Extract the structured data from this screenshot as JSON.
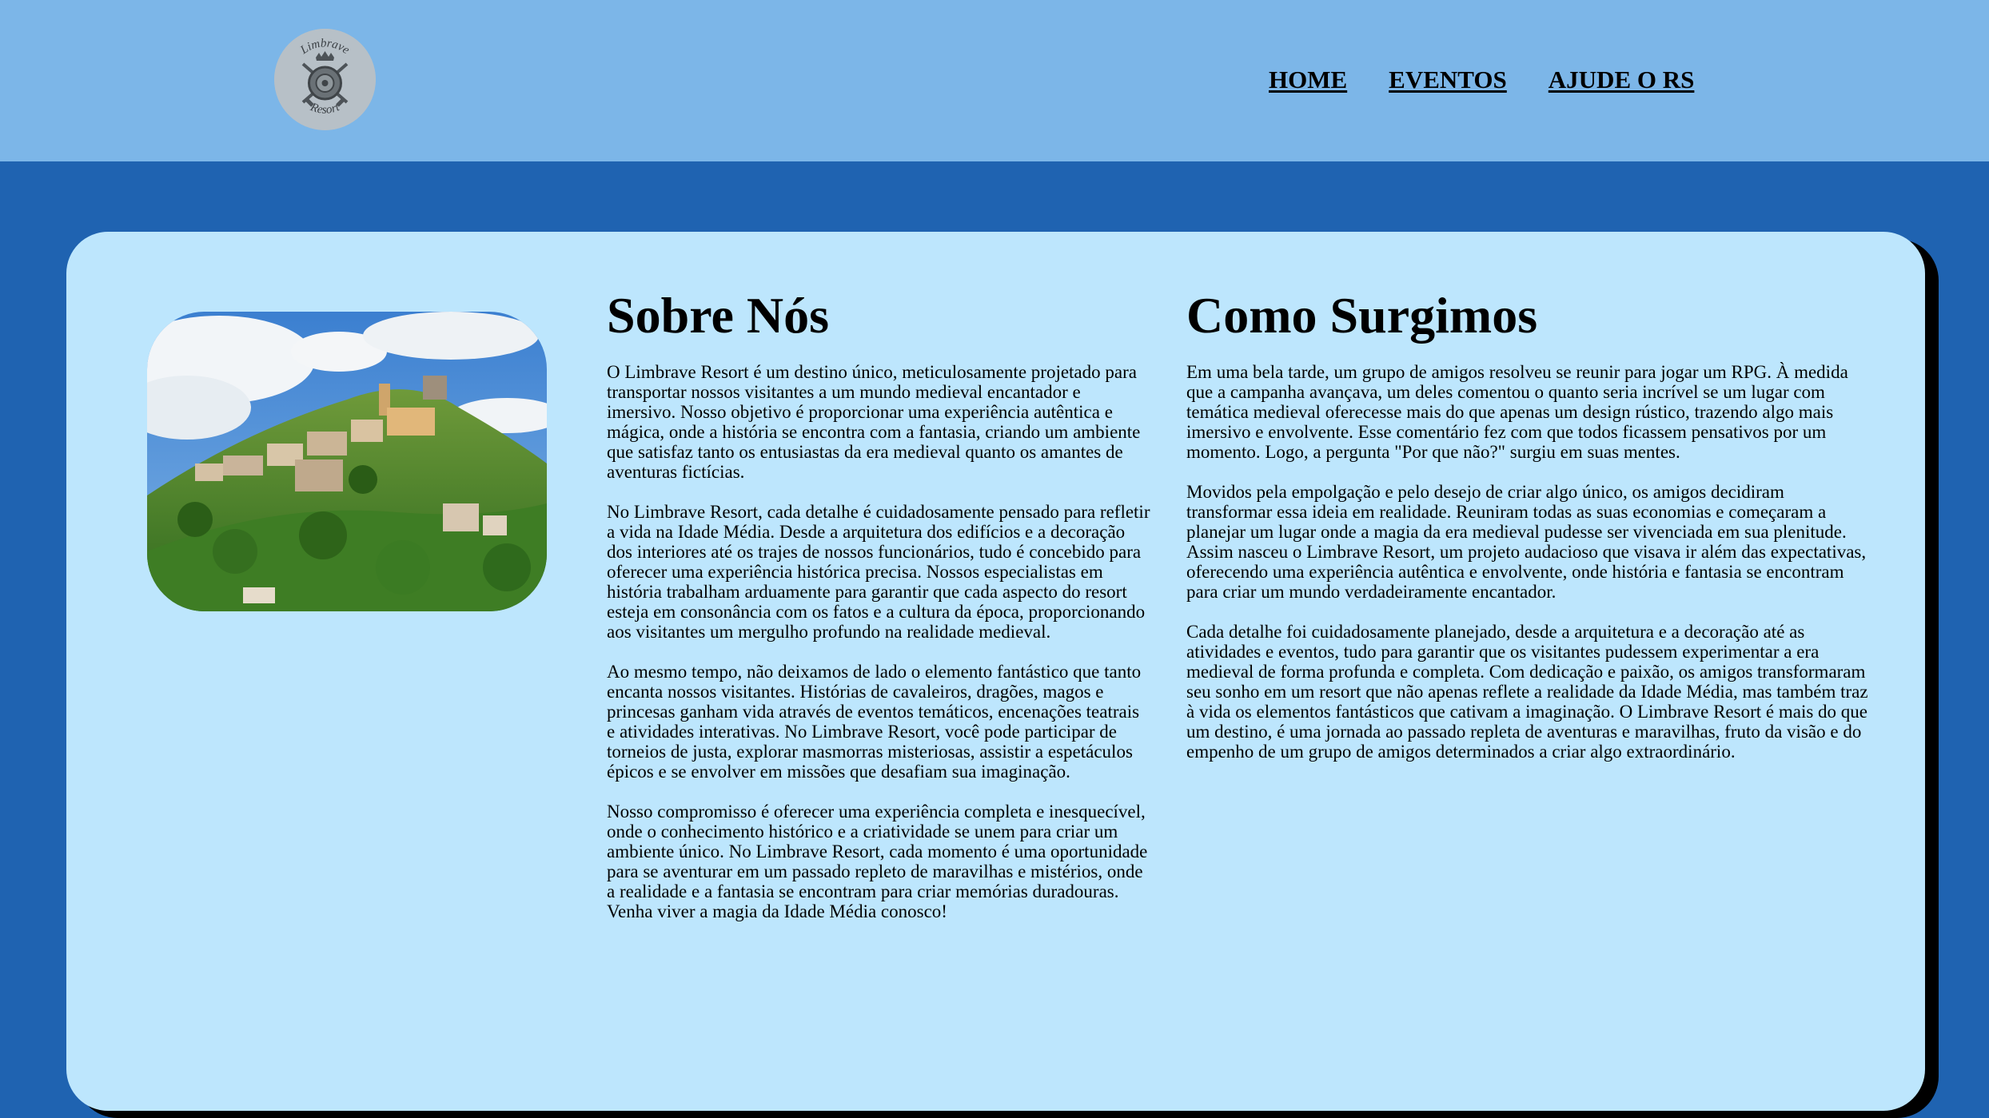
{
  "header": {
    "logo": {
      "icon": "shield-crossed-swords-logo",
      "text_top": "Limbrave",
      "text_bottom": "Resort"
    },
    "nav": [
      {
        "label": "HOME"
      },
      {
        "label": "EVENTOS"
      },
      {
        "label": "AJUDE O RS"
      }
    ]
  },
  "colors": {
    "header_bg": "#7cb6e8",
    "page_bg": "#1f63b1",
    "panel_bg": "#bde6fd",
    "panel_shadow": "#000000"
  },
  "main": {
    "image": {
      "subject": "medieval hilltop village photo"
    },
    "about": {
      "title": "Sobre Nós",
      "paragraphs": [
        "O Limbrave Resort é um destino único, meticulosamente projetado para transportar nossos visitantes a um mundo medieval encantador e imersivo. Nosso objetivo é proporcionar uma experiência autêntica e mágica, onde a história se encontra com a fantasia, criando um ambiente que satisfaz tanto os entusiastas da era medieval quanto os amantes de aventuras fictícias.",
        "No Limbrave Resort, cada detalhe é cuidadosamente pensado para refletir a vida na Idade Média. Desde a arquitetura dos edifícios e a decoração dos interiores até os trajes de nossos funcionários, tudo é concebido para oferecer uma experiência histórica precisa. Nossos especialistas em história trabalham arduamente para garantir que cada aspecto do resort esteja em consonância com os fatos e a cultura da época, proporcionando aos visitantes um mergulho profundo na realidade medieval.",
        "Ao mesmo tempo, não deixamos de lado o elemento fantástico que tanto encanta nossos visitantes. Histórias de cavaleiros, dragões, magos e princesas ganham vida através de eventos temáticos, encenações teatrais e atividades interativas. No Limbrave Resort, você pode participar de torneios de justa, explorar masmorras misteriosas, assistir a espetáculos épicos e se envolver em missões que desafiam sua imaginação.",
        "Nosso compromisso é oferecer uma experiência completa e inesquecível, onde o conhecimento histórico e a criatividade se unem para criar um ambiente único. No Limbrave Resort, cada momento é uma oportunidade para se aventurar em um passado repleto de maravilhas e mistérios, onde a realidade e a fantasia se encontram para criar memórias duradouras. Venha viver a magia da Idade Média conosco!"
      ]
    },
    "origin": {
      "title": "Como Surgimos",
      "paragraphs": [
        "Em uma bela tarde, um grupo de amigos resolveu se reunir para jogar um RPG. À medida que a campanha avançava, um deles comentou o quanto seria incrível se um lugar com temática medieval oferecesse mais do que apenas um design rústico, trazendo algo mais imersivo e envolvente. Esse comentário fez com que todos ficassem pensativos por um momento. Logo, a pergunta \"Por que não?\" surgiu em suas mentes.",
        "Movidos pela empolgação e pelo desejo de criar algo único, os amigos decidiram transformar essa ideia em realidade. Reuniram todas as suas economias e começaram a planejar um lugar onde a magia da era medieval pudesse ser vivenciada em sua plenitude. Assim nasceu o Limbrave Resort, um projeto audacioso que visava ir além das expectativas, oferecendo uma experiência autêntica e envolvente, onde história e fantasia se encontram para criar um mundo verdadeiramente encantador.",
        "Cada detalhe foi cuidadosamente planejado, desde a arquitetura e a decoração até as atividades e eventos, tudo para garantir que os visitantes pudessem experimentar a era medieval de forma profunda e completa. Com dedicação e paixão, os amigos transformaram seu sonho em um resort que não apenas reflete a realidade da Idade Média, mas também traz à vida os elementos fantásticos que cativam a imaginação. O Limbrave Resort é mais do que um destino, é uma jornada ao passado repleta de aventuras e maravilhas, fruto da visão e do empenho de um grupo de amigos determinados a criar algo extraordinário."
      ]
    }
  }
}
